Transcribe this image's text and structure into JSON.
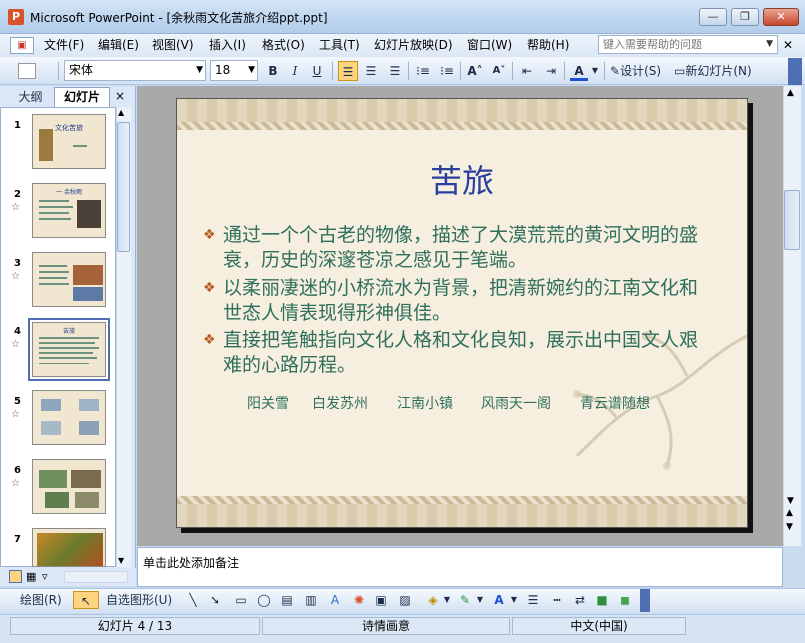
{
  "window": {
    "title": "Microsoft PowerPoint - [余秋雨文化苦旅介绍ppt.ppt]",
    "icon_letter": "P",
    "minimize_glyph": "—",
    "restore_glyph": "❐",
    "close_glyph": "✕"
  },
  "menu": {
    "items": [
      "文件(F)",
      "编辑(E)",
      "视图(V)",
      "插入(I)",
      "格式(O)",
      "工具(T)",
      "幻灯片放映(D)",
      "窗口(W)",
      "帮助(H)"
    ],
    "help_placeholder": "键入需要帮助的问题"
  },
  "toolbar": {
    "font": "宋体",
    "size": "18",
    "bold": "B",
    "italic": "I",
    "underline": "U",
    "design_label": "设计(S)",
    "new_slide_label": "新幻灯片(N)"
  },
  "left_pane": {
    "tab_outline": "大纲",
    "tab_slides": "幻灯片",
    "close": "×",
    "thumbnails": [
      {
        "num": "1",
        "title": "文化苦旅"
      },
      {
        "num": "2",
        "title": "一 余秋雨"
      },
      {
        "num": "3",
        "title": ""
      },
      {
        "num": "4",
        "title": "苦旅"
      },
      {
        "num": "5",
        "title": ""
      },
      {
        "num": "6",
        "title": ""
      },
      {
        "num": "7",
        "title": ""
      }
    ]
  },
  "slide": {
    "title": "苦旅",
    "bullets": [
      "通过一个个古老的物像，描述了大漠荒荒的黄河文明的盛衰，历史的深邃苍凉之感见于笔端。",
      "以柔丽凄迷的小桥流水为背景，把清新婉约的江南文化和世态人情表现得形神俱佳。",
      "直接把笔触指向文化人格和文化良知，展示出中国文人艰难的心路历程。"
    ],
    "links": [
      "阳关雪",
      "白发苏州",
      "江南小镇",
      "风雨天一阁",
      "青云谱随想"
    ]
  },
  "notes": {
    "placeholder": "单击此处添加备注"
  },
  "draw_toolbar": {
    "draw_label": "绘图(R)",
    "autoshape_label": "自选图形(U)"
  },
  "status": {
    "slide_info": "幻灯片 4 / 13",
    "design": "诗情画意",
    "language": "中文(中国)"
  }
}
